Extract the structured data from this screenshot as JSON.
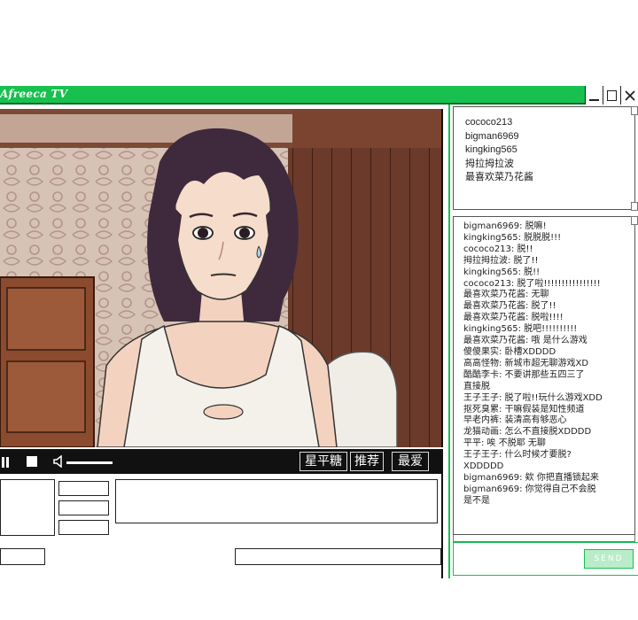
{
  "window": {
    "title": "Afreeca TV"
  },
  "player": {
    "buttons": [
      "星平糖",
      "推荐",
      "最爱"
    ]
  },
  "users": [
    "cococo213",
    "bigman6969",
    "kingking565",
    "拇拉拇拉波",
    "最喜欢菜乃花酱"
  ],
  "chat": [
    "bigman6969: 脱嘛!",
    "kingking565: 脱脱脱!!!",
    "cococo213: 脱!!",
    "拇拉拇拉波: 脱了!!",
    "kingking565: 脱!!",
    "cococo213: 脱了啦!!!!!!!!!!!!!!!!",
    "最喜欢菜乃花酱: 无聊",
    "最喜欢菜乃花酱: 脱了!!",
    "最喜欢菜乃花酱: 脱啦!!!!",
    "kingking565: 脱吧!!!!!!!!!!",
    "最喜欢菜乃花酱: 哦 是什么游戏",
    "傻傻果实: 卧槽XDDDD",
    "高高怪物: 新城市超无聊游戏XD",
    "酷酷李卡: 不要讲那些五四三了",
    "直接脱",
    "王子王子: 脱了啦!!玩什么游戏XDD",
    "抠死臭累: 干嘛假装是知性频道",
    "早老内裤: 装清高有够恶心",
    "龙猫动画: 怎么不直接脱XDDDD",
    "平平: 唉 不脱耶 无聊",
    "王子王子: 什么时候才要脱?",
    "XDDDDD",
    "bigman6969: 欸 你把直播锁起来",
    "bigman6969: 你觉得自己不会脱",
    "是不是"
  ],
  "send_label": "SEND",
  "colors": {
    "accent": "#18c04f"
  }
}
